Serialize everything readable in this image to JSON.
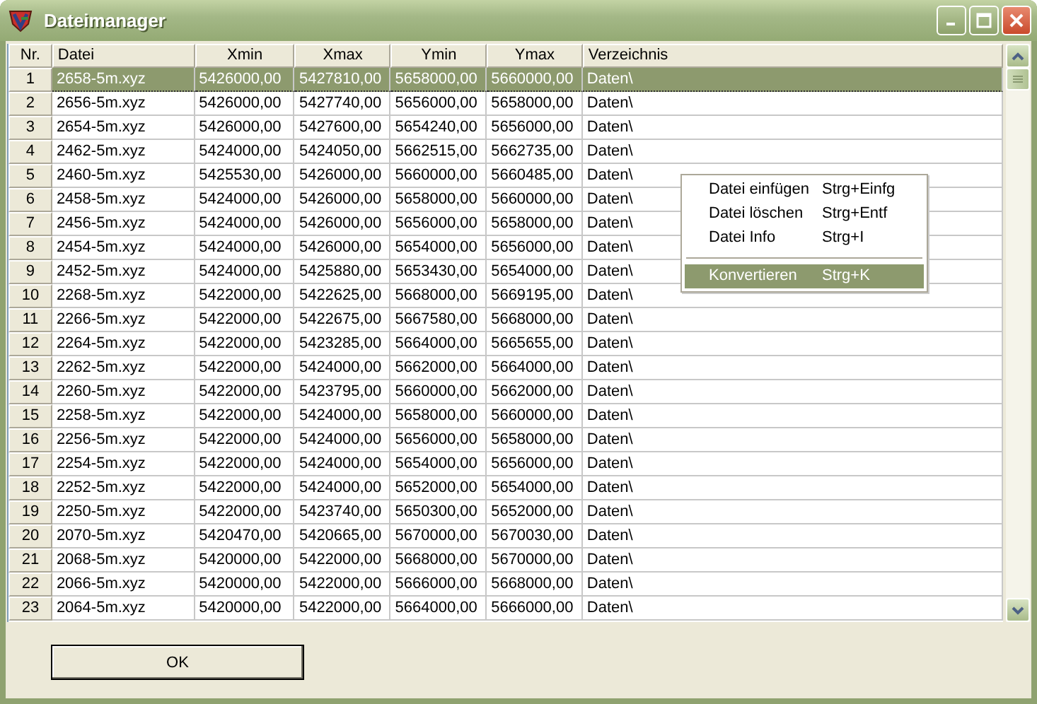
{
  "window": {
    "title": "Dateimanager"
  },
  "table": {
    "columns": [
      "Nr.",
      "Datei",
      "Xmin",
      "Xmax",
      "Ymin",
      "Ymax",
      "Verzeichnis"
    ],
    "rows": [
      {
        "selected": true,
        "cells": [
          "1",
          "2658-5m.xyz",
          "5426000,00",
          "5427810,00",
          "5658000,00",
          "5660000,00",
          "Daten\\"
        ]
      },
      {
        "selected": false,
        "cells": [
          "2",
          "2656-5m.xyz",
          "5426000,00",
          "5427740,00",
          "5656000,00",
          "5658000,00",
          "Daten\\"
        ]
      },
      {
        "selected": false,
        "cells": [
          "3",
          "2654-5m.xyz",
          "5426000,00",
          "5427600,00",
          "5654240,00",
          "5656000,00",
          "Daten\\"
        ]
      },
      {
        "selected": false,
        "cells": [
          "4",
          "2462-5m.xyz",
          "5424000,00",
          "5424050,00",
          "5662515,00",
          "5662735,00",
          "Daten\\"
        ]
      },
      {
        "selected": false,
        "cells": [
          "5",
          "2460-5m.xyz",
          "5425530,00",
          "5426000,00",
          "5660000,00",
          "5660485,00",
          "Daten\\"
        ]
      },
      {
        "selected": false,
        "cells": [
          "6",
          "2458-5m.xyz",
          "5424000,00",
          "5426000,00",
          "5658000,00",
          "5660000,00",
          "Daten\\"
        ]
      },
      {
        "selected": false,
        "cells": [
          "7",
          "2456-5m.xyz",
          "5424000,00",
          "5426000,00",
          "5656000,00",
          "5658000,00",
          "Daten\\"
        ]
      },
      {
        "selected": false,
        "cells": [
          "8",
          "2454-5m.xyz",
          "5424000,00",
          "5426000,00",
          "5654000,00",
          "5656000,00",
          "Daten\\"
        ]
      },
      {
        "selected": false,
        "cells": [
          "9",
          "2452-5m.xyz",
          "5424000,00",
          "5425880,00",
          "5653430,00",
          "5654000,00",
          "Daten\\"
        ]
      },
      {
        "selected": false,
        "cells": [
          "10",
          "2268-5m.xyz",
          "5422000,00",
          "5422625,00",
          "5668000,00",
          "5669195,00",
          "Daten\\"
        ]
      },
      {
        "selected": false,
        "cells": [
          "11",
          "2266-5m.xyz",
          "5422000,00",
          "5422675,00",
          "5667580,00",
          "5668000,00",
          "Daten\\"
        ]
      },
      {
        "selected": false,
        "cells": [
          "12",
          "2264-5m.xyz",
          "5422000,00",
          "5423285,00",
          "5664000,00",
          "5665655,00",
          "Daten\\"
        ]
      },
      {
        "selected": false,
        "cells": [
          "13",
          "2262-5m.xyz",
          "5422000,00",
          "5424000,00",
          "5662000,00",
          "5664000,00",
          "Daten\\"
        ]
      },
      {
        "selected": false,
        "cells": [
          "14",
          "2260-5m.xyz",
          "5422000,00",
          "5423795,00",
          "5660000,00",
          "5662000,00",
          "Daten\\"
        ]
      },
      {
        "selected": false,
        "cells": [
          "15",
          "2258-5m.xyz",
          "5422000,00",
          "5424000,00",
          "5658000,00",
          "5660000,00",
          "Daten\\"
        ]
      },
      {
        "selected": false,
        "cells": [
          "16",
          "2256-5m.xyz",
          "5422000,00",
          "5424000,00",
          "5656000,00",
          "5658000,00",
          "Daten\\"
        ]
      },
      {
        "selected": false,
        "cells": [
          "17",
          "2254-5m.xyz",
          "5422000,00",
          "5424000,00",
          "5654000,00",
          "5656000,00",
          "Daten\\"
        ]
      },
      {
        "selected": false,
        "cells": [
          "18",
          "2252-5m.xyz",
          "5422000,00",
          "5424000,00",
          "5652000,00",
          "5654000,00",
          "Daten\\"
        ]
      },
      {
        "selected": false,
        "cells": [
          "19",
          "2250-5m.xyz",
          "5422000,00",
          "5423740,00",
          "5650300,00",
          "5652000,00",
          "Daten\\"
        ]
      },
      {
        "selected": false,
        "cells": [
          "20",
          "2070-5m.xyz",
          "5420470,00",
          "5420665,00",
          "5670000,00",
          "5670030,00",
          "Daten\\"
        ]
      },
      {
        "selected": false,
        "cells": [
          "21",
          "2068-5m.xyz",
          "5420000,00",
          "5422000,00",
          "5668000,00",
          "5670000,00",
          "Daten\\"
        ]
      },
      {
        "selected": false,
        "cells": [
          "22",
          "2066-5m.xyz",
          "5420000,00",
          "5422000,00",
          "5666000,00",
          "5668000,00",
          "Daten\\"
        ]
      },
      {
        "selected": false,
        "cells": [
          "23",
          "2064-5m.xyz",
          "5420000,00",
          "5422000,00",
          "5664000,00",
          "5666000,00",
          "Daten\\"
        ]
      }
    ]
  },
  "context_menu": {
    "items": [
      {
        "label": "Datei einfügen",
        "shortcut": "Strg+Einfg",
        "selected": false
      },
      {
        "label": "Datei löschen",
        "shortcut": "Strg+Entf",
        "selected": false
      },
      {
        "label": "Datei Info",
        "shortcut": "Strg+I",
        "selected": false
      },
      {
        "kind": "separator"
      },
      {
        "label": "Konvertieren",
        "shortcut": "Strg+K",
        "selected": true
      }
    ]
  },
  "buttons": [
    "OK"
  ]
}
